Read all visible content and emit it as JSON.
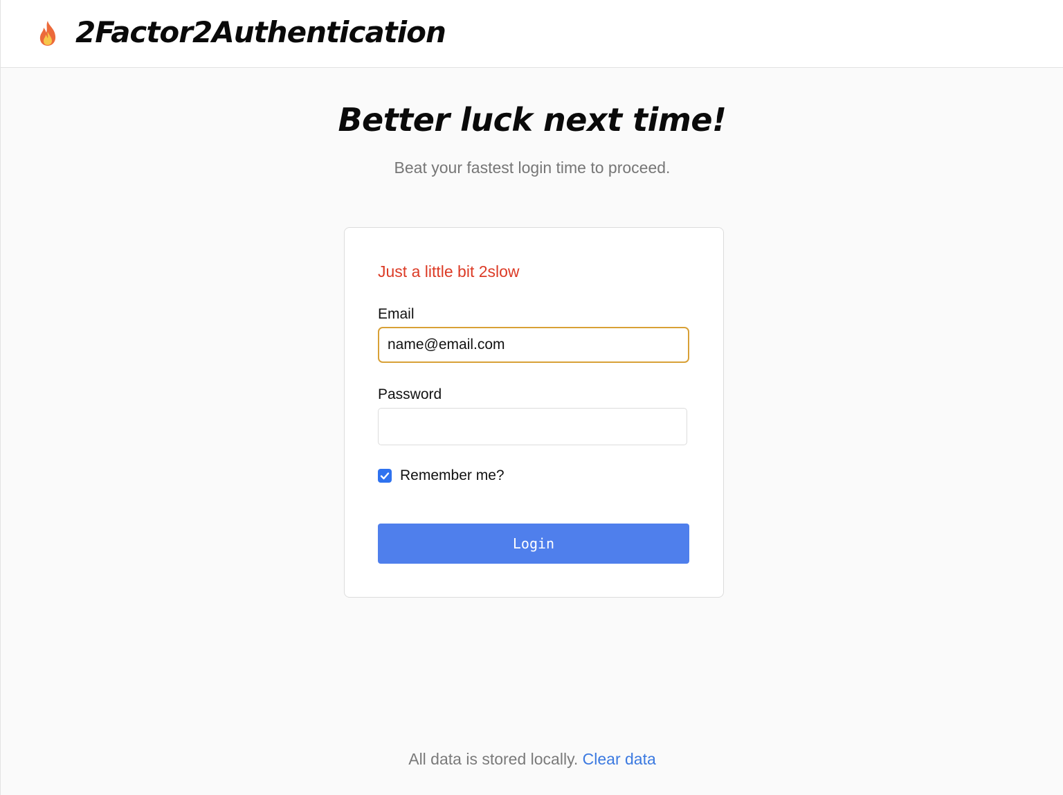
{
  "header": {
    "logo_icon": "fire-icon",
    "app_title": "2Factor2Authentication"
  },
  "main": {
    "heading": "Better luck next time!",
    "subheading": "Beat your fastest login time to proceed."
  },
  "login_form": {
    "error_message": "Just a little bit 2slow",
    "email_label": "Email",
    "email_value": "name@email.com",
    "password_label": "Password",
    "password_value": "",
    "remember_label": "Remember me?",
    "remember_checked": true,
    "login_label": "Login"
  },
  "footer": {
    "text": "All data is stored locally.",
    "clear_link": "Clear data"
  },
  "colors": {
    "error": "#dc3b26",
    "button": "#4f7fec",
    "focus_border": "#d8a036",
    "link": "#3b79e0"
  }
}
